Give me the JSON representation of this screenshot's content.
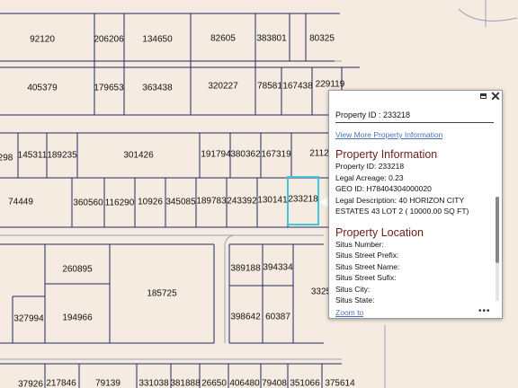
{
  "map": {
    "parcel_ids": [
      "92120",
      "206206",
      "134650",
      "82605",
      "383801",
      "80325",
      "405379",
      "179653",
      "363438",
      "320227",
      "78581",
      "167438",
      "229119",
      "298",
      "145311",
      "189235",
      "301426",
      "191794",
      "380362",
      "167319",
      "2112",
      "74449",
      "360560",
      "116290",
      "10926",
      "345085",
      "189783",
      "243392",
      "130141",
      "233218",
      "260895",
      "185725",
      "327994",
      "194966",
      "389188",
      "394334",
      "3325",
      "398642",
      "60387",
      "37926",
      "217846",
      "79139",
      "331038",
      "381888",
      "26650",
      "406480",
      "79408",
      "351066",
      "375614"
    ],
    "selected_parcel": "233218"
  },
  "popup": {
    "title": "Property ID : 233218",
    "view_more_link": "View More Property Information",
    "info_heading": "Property Information",
    "info_rows": [
      "Property ID: 233218",
      "Legal Acreage: 0.23",
      "GEO ID: H78404304000020",
      "Legal Description: 40 HORIZON CITY ESTATES 43 LOT 2 ( 10000.00 SQ FT)"
    ],
    "location_heading": "Property Location",
    "location_rows": [
      "Situs Number:",
      "Situs Street Prefix:",
      "Situs Street Name:",
      "Situs Street Sufix:",
      "Situs City:",
      "Situs State:"
    ],
    "zoom_link": "Zoom to",
    "more_label": "•••",
    "close_label": "✕"
  },
  "colors": {
    "background": "#f6ebe1",
    "parcel_line": "#1f2a5e",
    "street_line": "#9aa0b4",
    "selected": "#42c6db",
    "heading": "#6b1e17",
    "link": "#4575b4"
  }
}
